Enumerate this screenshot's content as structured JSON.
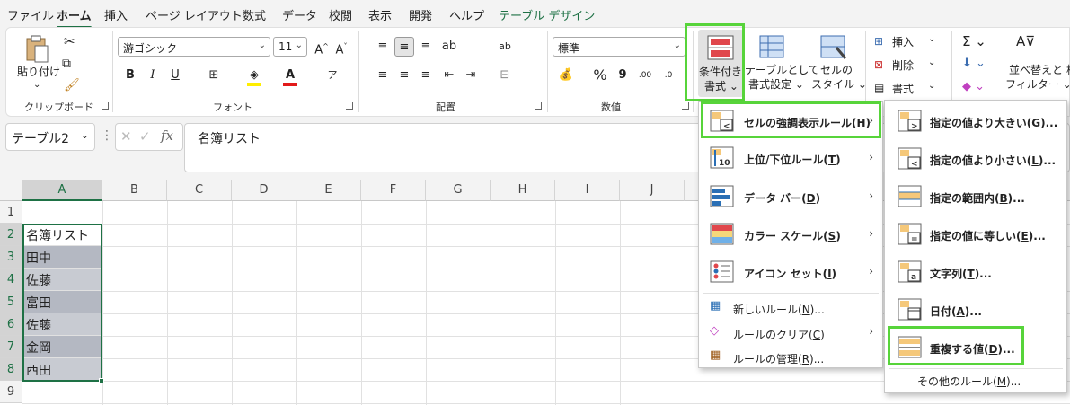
{
  "tabs": [
    "ファイル",
    "ホーム",
    "挿入",
    "ページ レイアウト",
    "数式",
    "データ",
    "校閲",
    "表示",
    "開発",
    "ヘルプ",
    "テーブル デザイン"
  ],
  "ribbon": {
    "clipboard": {
      "paste": "貼り付け",
      "label": "クリップボード"
    },
    "font": {
      "name": "游ゴシック",
      "size": "11",
      "label": "フォント",
      "bold": "B",
      "italic": "I",
      "underline": "U",
      "grow": "A^",
      "shrink": "A˅"
    },
    "align": {
      "label": "配置"
    },
    "number": {
      "format": "標準",
      "percent": "%",
      "comma": "9",
      "label": "数値"
    },
    "styles": {
      "cond_line1": "条件付き",
      "cond_line2": "書式 ⌄",
      "table_line1": "テーブルとして",
      "table_line2": "書式設定 ⌄",
      "cell_line1": "セルの",
      "cell_line2": "スタイル ⌄"
    },
    "cells": {
      "insert": "挿入",
      "delete": "削除",
      "format": "書式"
    },
    "editing": {
      "sort_line1": "並べ替えと",
      "sort_line2": "フィルター ⌄",
      "find_partial": "検"
    }
  },
  "formula_bar": {
    "name_box": "テーブル2",
    "content": "名簿リスト"
  },
  "grid": {
    "columns": [
      "A",
      "B",
      "C",
      "D",
      "E",
      "F",
      "G",
      "H",
      "I",
      "J"
    ],
    "rows": [
      "1",
      "2",
      "3",
      "4",
      "5",
      "6",
      "7",
      "8",
      "9"
    ],
    "cells_a": [
      "",
      "名簿リスト",
      "田中",
      "佐藤",
      "富田",
      "佐藤",
      "金岡",
      "西田",
      ""
    ]
  },
  "menu": {
    "items": [
      {
        "text": "セルの強調表示ルール(",
        "key": "H",
        "end": ")"
      },
      {
        "text": "上位/下位ルール(",
        "key": "T",
        "end": ")"
      },
      {
        "text": "データ バー(",
        "key": "D",
        "end": ")"
      },
      {
        "text": "カラー スケール(",
        "key": "S",
        "end": ")"
      },
      {
        "text": "アイコン セット(",
        "key": "I",
        "end": ")"
      }
    ],
    "small": [
      {
        "text": "新しいルール(",
        "key": "N",
        "end": ")..."
      },
      {
        "text": "ルールのクリア(",
        "key": "C",
        "end": ")"
      },
      {
        "text": "ルールの管理(",
        "key": "R",
        "end": ")..."
      }
    ]
  },
  "submenu": {
    "items": [
      {
        "text": "指定の値より大きい(",
        "key": "G",
        "end": ")..."
      },
      {
        "text": "指定の値より小さい(",
        "key": "L",
        "end": ")..."
      },
      {
        "text": "指定の範囲内(",
        "key": "B",
        "end": ")..."
      },
      {
        "text": "指定の値に等しい(",
        "key": "E",
        "end": ")..."
      },
      {
        "text": "文字列(",
        "key": "T",
        "end": ")..."
      },
      {
        "text": "日付(",
        "key": "A",
        "end": ")..."
      },
      {
        "text": "重複する値(",
        "key": "D",
        "end": ")..."
      }
    ],
    "other": {
      "text": "その他のルール(",
      "key": "M",
      "end": ")..."
    }
  },
  "colors": {
    "accent": "#1e7145",
    "highlight": "#57d43a",
    "table_fill": "#b4b8c2"
  }
}
